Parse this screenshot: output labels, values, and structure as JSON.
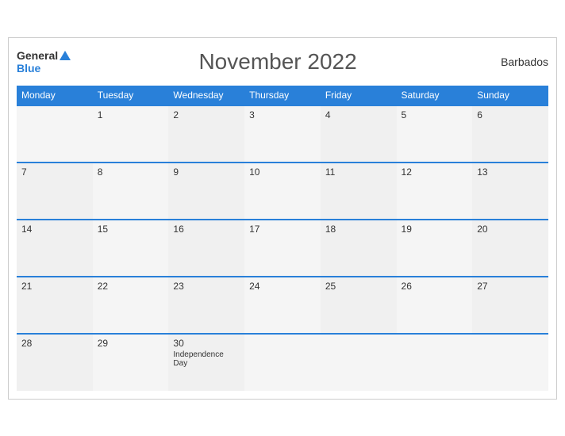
{
  "header": {
    "logo_general": "General",
    "logo_blue": "Blue",
    "month_title": "November 2022",
    "country": "Barbados"
  },
  "weekdays": [
    "Monday",
    "Tuesday",
    "Wednesday",
    "Thursday",
    "Friday",
    "Saturday",
    "Sunday"
  ],
  "weeks": [
    [
      {
        "day": "",
        "holiday": ""
      },
      {
        "day": "1",
        "holiday": ""
      },
      {
        "day": "2",
        "holiday": ""
      },
      {
        "day": "3",
        "holiday": ""
      },
      {
        "day": "4",
        "holiday": ""
      },
      {
        "day": "5",
        "holiday": ""
      },
      {
        "day": "6",
        "holiday": ""
      }
    ],
    [
      {
        "day": "7",
        "holiday": ""
      },
      {
        "day": "8",
        "holiday": ""
      },
      {
        "day": "9",
        "holiday": ""
      },
      {
        "day": "10",
        "holiday": ""
      },
      {
        "day": "11",
        "holiday": ""
      },
      {
        "day": "12",
        "holiday": ""
      },
      {
        "day": "13",
        "holiday": ""
      }
    ],
    [
      {
        "day": "14",
        "holiday": ""
      },
      {
        "day": "15",
        "holiday": ""
      },
      {
        "day": "16",
        "holiday": ""
      },
      {
        "day": "17",
        "holiday": ""
      },
      {
        "day": "18",
        "holiday": ""
      },
      {
        "day": "19",
        "holiday": ""
      },
      {
        "day": "20",
        "holiday": ""
      }
    ],
    [
      {
        "day": "21",
        "holiday": ""
      },
      {
        "day": "22",
        "holiday": ""
      },
      {
        "day": "23",
        "holiday": ""
      },
      {
        "day": "24",
        "holiday": ""
      },
      {
        "day": "25",
        "holiday": ""
      },
      {
        "day": "26",
        "holiday": ""
      },
      {
        "day": "27",
        "holiday": ""
      }
    ],
    [
      {
        "day": "28",
        "holiday": ""
      },
      {
        "day": "29",
        "holiday": ""
      },
      {
        "day": "30",
        "holiday": "Independence Day"
      },
      {
        "day": "",
        "holiday": ""
      },
      {
        "day": "",
        "holiday": ""
      },
      {
        "day": "",
        "holiday": ""
      },
      {
        "day": "",
        "holiday": ""
      }
    ]
  ]
}
